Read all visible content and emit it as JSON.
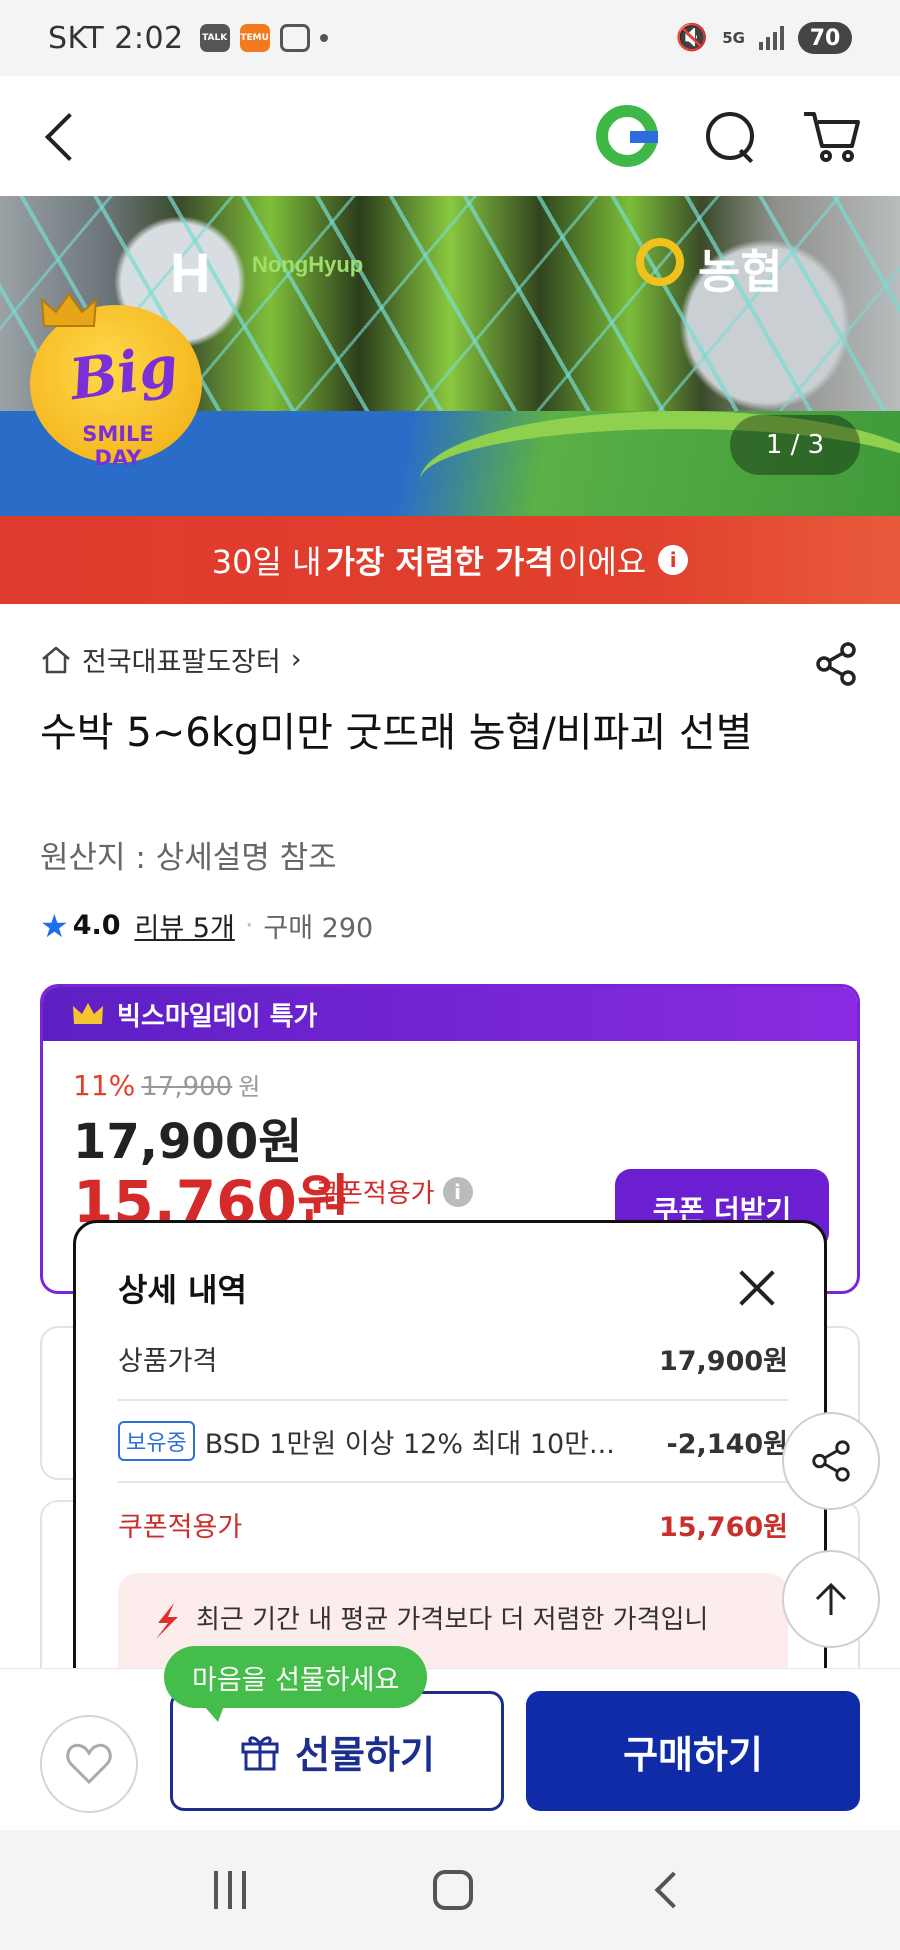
{
  "status_bar": {
    "carrier_time": "SKT 2:02",
    "talk_icon": "TALK",
    "temu_icon": "TEMU",
    "network": "5G",
    "battery": "70"
  },
  "header": {
    "back_icon": "chevron-left-icon",
    "logo_icon": "g-logo-icon",
    "search_icon": "search-icon",
    "cart_icon": "cart-icon"
  },
  "hero": {
    "badge_big": "Big",
    "badge_smile_day": "SMILE DAY",
    "nh_text": "NongHyup",
    "nh_left": "H",
    "nh_right_text": "농협",
    "page_counter": "1 / 3"
  },
  "price_banner": {
    "prefix": "30일 내 ",
    "highlight": "가장 저렴한 가격",
    "suffix": "이에요",
    "info": "i"
  },
  "product": {
    "shop_name": "전국대표팔도장터",
    "title": "수박 5~6kg미만 굿뜨래 농협/비파괴 선별",
    "origin": "원산지 : 상세설명 참조",
    "rating": "4.0",
    "review": "리뷰 5개",
    "purchases": "구매 290"
  },
  "deal": {
    "header": "빅스마일데이 특가",
    "discount": "11%",
    "original_price": "17,900",
    "original_unit": "원",
    "price": "17,900원",
    "coupon_price": "15,760원",
    "coupon_label": "쿠폰적용가",
    "coupon_button": "쿠폰 더받기"
  },
  "popup": {
    "title": "상세 내역",
    "rows": [
      {
        "label": "상품가격",
        "value": "17,900원"
      },
      {
        "tag": "보유중",
        "label": "BSD 1만원 이상 12% 최대 10만...",
        "value": "-2,140원"
      },
      {
        "label": "쿠폰적용가",
        "value": "15,760원"
      }
    ],
    "notice": "최근 기간 내 평균 가격보다 더 저렴한 가격입니"
  },
  "bottom_bar": {
    "tooltip": "마음을 선물하세요",
    "gift_label": "선물하기",
    "buy_label": "구매하기"
  },
  "colors": {
    "accent_purple": "#7a26d8",
    "price_red": "#d42a2a",
    "buy_blue": "#0f2ba8",
    "tooltip_green": "#44bd4a"
  }
}
